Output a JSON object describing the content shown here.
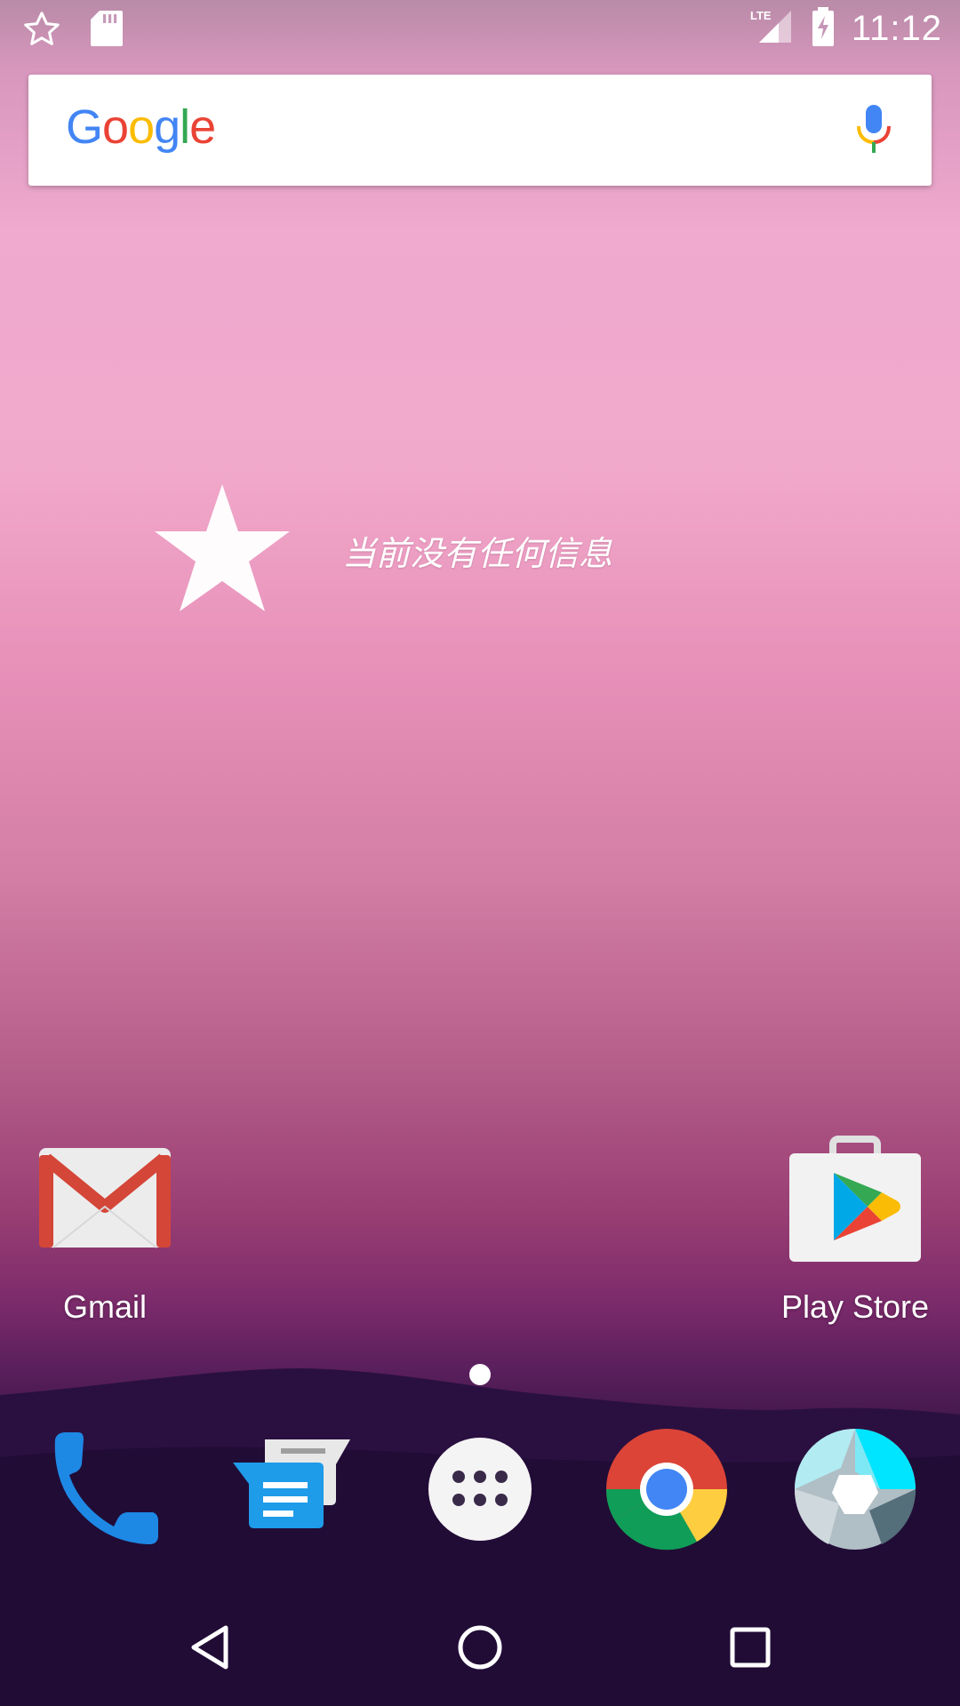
{
  "status_bar": {
    "time": "11:12",
    "network": "LTE",
    "icons": [
      "star-outline-icon",
      "sd-card-icon",
      "lte-signal-icon",
      "battery-charging-icon"
    ]
  },
  "search_widget": {
    "logo_letters": [
      {
        "char": "G",
        "color": "#4285F4"
      },
      {
        "char": "o",
        "color": "#EA4335"
      },
      {
        "char": "o",
        "color": "#FBBC05"
      },
      {
        "char": "g",
        "color": "#4285F4"
      },
      {
        "char": "l",
        "color": "#34A853"
      },
      {
        "char": "e",
        "color": "#EA4335"
      }
    ],
    "mic_icon": "microphone-icon"
  },
  "message_widget": {
    "icon": "star-icon",
    "text": "当前没有任何信息"
  },
  "home_apps": [
    {
      "label": "Gmail",
      "icon": "gmail-icon"
    },
    {
      "label": "Play Store",
      "icon": "play-store-icon"
    }
  ],
  "dock": [
    {
      "icon": "phone-icon"
    },
    {
      "icon": "messages-icon"
    },
    {
      "icon": "app-drawer-icon"
    },
    {
      "icon": "chrome-icon"
    },
    {
      "icon": "camera-icon"
    }
  ],
  "nav": [
    "back-icon",
    "home-icon",
    "recents-icon"
  ],
  "colors": {
    "google_blue": "#4285F4",
    "google_red": "#EA4335",
    "google_yellow": "#FBBC05",
    "google_green": "#34A853"
  }
}
